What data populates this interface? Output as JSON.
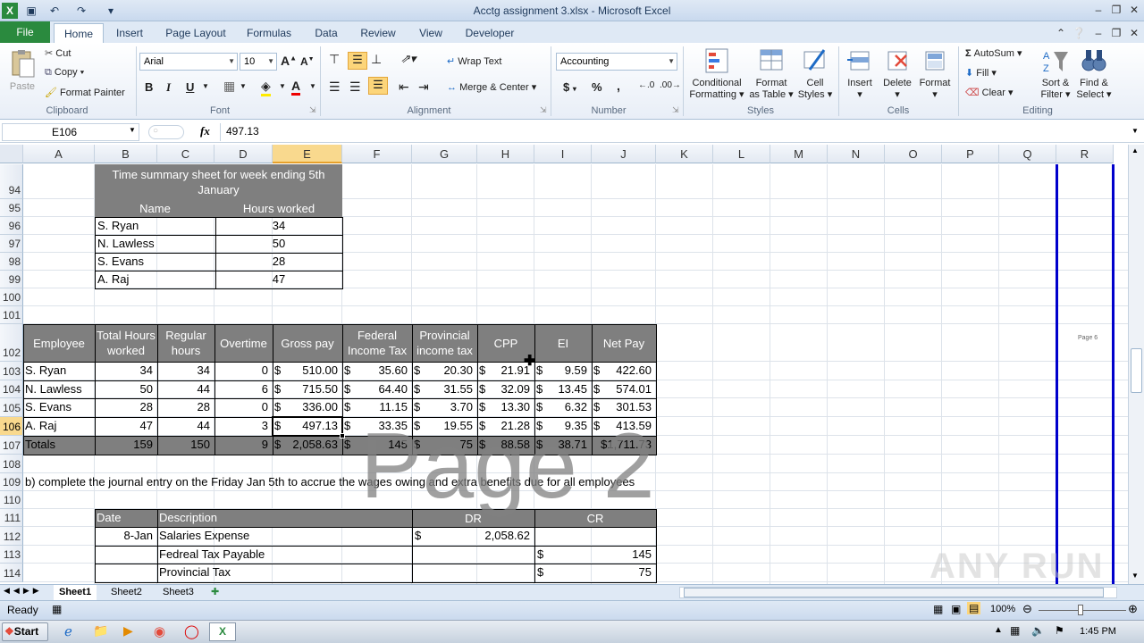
{
  "window": {
    "title": "Acctg assignment 3.xlsx - Microsoft Excel",
    "quick_access": [
      "save-icon",
      "undo-icon",
      "redo-icon"
    ]
  },
  "tabs": [
    "File",
    "Home",
    "Insert",
    "Page Layout",
    "Formulas",
    "Data",
    "Review",
    "View",
    "Developer"
  ],
  "ribbon": {
    "clipboard": {
      "paste": "Paste",
      "cut": "Cut",
      "copy": "Copy",
      "format_painter": "Format Painter",
      "label": "Clipboard"
    },
    "font": {
      "name": "Arial",
      "size": "10",
      "bold": "B",
      "italic": "I",
      "underline": "U",
      "label": "Font"
    },
    "alignment": {
      "wrap_text": "Wrap Text",
      "merge_center": "Merge & Center",
      "label": "Alignment"
    },
    "number": {
      "format": "Accounting",
      "currency": "$",
      "percent": "%",
      "comma": ",",
      "label": "Number"
    },
    "styles": {
      "conditional": "Conditional",
      "conditional2": "Formatting",
      "format_table": "Format",
      "format_table2": "as Table",
      "cell_styles": "Cell",
      "cell_styles2": "Styles",
      "label": "Styles"
    },
    "cells": {
      "insert": "Insert",
      "delete": "Delete",
      "format": "Format",
      "label": "Cells"
    },
    "editing": {
      "autosum": "AutoSum",
      "fill": "Fill",
      "clear": "Clear",
      "sort": "Sort &",
      "sort2": "Filter",
      "find": "Find &",
      "find2": "Select",
      "label": "Editing"
    }
  },
  "formula_bar": {
    "name_box": "E106",
    "fx": "fx",
    "value": "497.13"
  },
  "columns": [
    "A",
    "B",
    "C",
    "D",
    "E",
    "F",
    "G",
    "H",
    "I",
    "J",
    "K",
    "L",
    "M",
    "N",
    "O",
    "P",
    "Q",
    "R"
  ],
  "rows": [
    "94",
    "95",
    "96",
    "97",
    "98",
    "99",
    "100",
    "101",
    "102",
    "103",
    "104",
    "105",
    "106",
    "107",
    "108",
    "109",
    "110",
    "111",
    "112",
    "113",
    "114"
  ],
  "summary": {
    "title": "Time summary sheet for week ending 5th January",
    "headers": [
      "Name",
      "Hours worked"
    ],
    "rows": [
      [
        "S. Ryan",
        "34"
      ],
      [
        "N. Lawless",
        "50"
      ],
      [
        "S. Evans",
        "28"
      ],
      [
        "A. Raj",
        "47"
      ]
    ]
  },
  "payroll": {
    "headers": [
      "Employee",
      "Total Hours worked",
      "Regular hours",
      "Overtime",
      "Gross pay",
      "Federal Income Tax",
      "Provincial income tax",
      "CPP",
      "EI",
      "Net Pay"
    ],
    "rows": [
      [
        "S. Ryan",
        "34",
        "34",
        "0",
        "510.00",
        "35.60",
        "20.30",
        "21.91",
        "9.59",
        "422.60"
      ],
      [
        "N. Lawless",
        "50",
        "44",
        "6",
        "715.50",
        "64.40",
        "31.55",
        "32.09",
        "13.45",
        "574.01"
      ],
      [
        "S. Evans",
        "28",
        "28",
        "0",
        "336.00",
        "11.15",
        "3.70",
        "13.30",
        "6.32",
        "301.53"
      ],
      [
        "A. Raj",
        "47",
        "44",
        "3",
        "497.13",
        "33.35",
        "19.55",
        "21.28",
        "9.35",
        "413.59"
      ]
    ],
    "totals": [
      "Totals",
      "159",
      "150",
      "9",
      "2,058.63",
      "145",
      "75",
      "88.58",
      "38.71",
      "$1,711.73"
    ],
    "currency": "$"
  },
  "instruction": "b) complete the journal entry on the Friday Jan 5th to accrue the wages owing and extra benefits due for all employees",
  "journal": {
    "headers": [
      "Date",
      "Description",
      "DR",
      "CR"
    ],
    "rows": [
      [
        "8-Jan",
        "Salaries Expense",
        "$",
        "2,058.62",
        "",
        ""
      ],
      [
        "",
        "Fedreal Tax Payable",
        "",
        "",
        "$",
        "145"
      ],
      [
        "",
        "Provincial Tax",
        "",
        "",
        "$",
        "75"
      ]
    ]
  },
  "watermark": "Page 2",
  "page_label_small": "Page 6",
  "sheets": [
    "Sheet1",
    "Sheet2",
    "Sheet3"
  ],
  "status": {
    "ready": "Ready",
    "zoom": "100%"
  },
  "taskbar": {
    "start": "Start",
    "time": "1:45 PM"
  },
  "brand_watermark": "ANY RUN"
}
